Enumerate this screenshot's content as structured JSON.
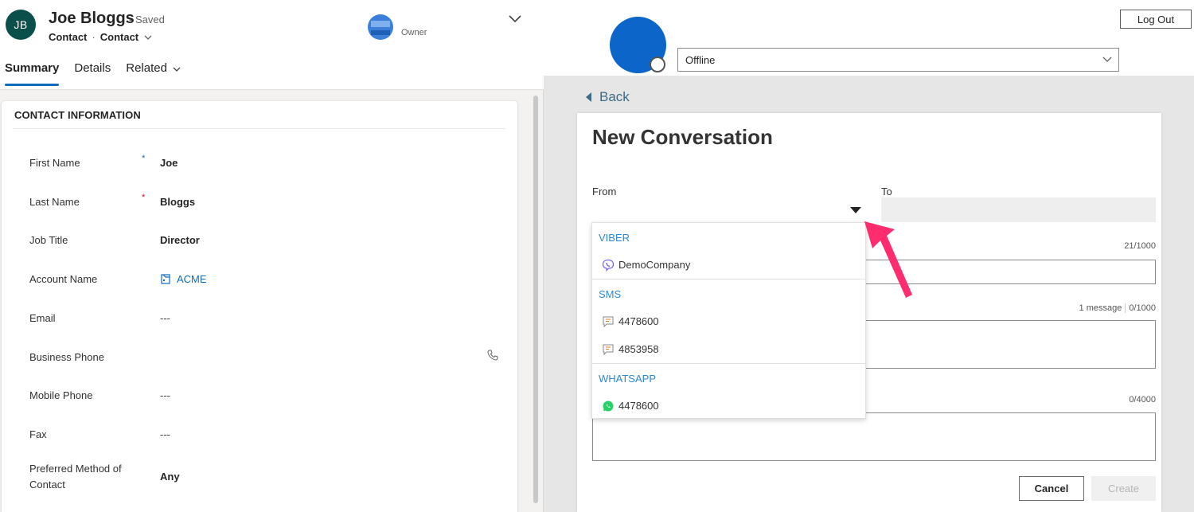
{
  "record": {
    "initials": "JB",
    "name": "Joe Bloggs",
    "saved": "- Saved",
    "entity": "Contact",
    "form": "Contact",
    "owner_label": "Owner"
  },
  "tabs": [
    {
      "label": "Summary"
    },
    {
      "label": "Details"
    },
    {
      "label": "Related"
    }
  ],
  "contact_section": {
    "title": "CONTACT INFORMATION",
    "fields": [
      {
        "label": "First Name",
        "required_marker": "*",
        "value": "Joe"
      },
      {
        "label": "Last Name",
        "required_marker": "*",
        "value": "Bloggs"
      },
      {
        "label": "Job Title",
        "value": "Director"
      },
      {
        "label": "Account Name",
        "value": "ACME"
      },
      {
        "label": "Email",
        "value": "---"
      },
      {
        "label": "Business Phone",
        "value": ""
      },
      {
        "label": "Mobile Phone",
        "value": "---"
      },
      {
        "label": "Fax",
        "value": "---"
      },
      {
        "label": "Preferred Method of Contact",
        "value": "Any"
      }
    ]
  },
  "agent": {
    "logout_label": "Log Out",
    "presence": "Offline"
  },
  "conversation": {
    "back_label": "Back",
    "title": "New Conversation",
    "from_label": "From",
    "to_label": "To",
    "counter_1": "21/1000",
    "counter_2_messages": "1 message",
    "counter_2": "0/1000",
    "counter_3": "0/4000",
    "cancel_label": "Cancel",
    "create_label": "Create"
  },
  "from_dropdown": {
    "groups": [
      {
        "name": "VIBER",
        "items": [
          {
            "label": "DemoCompany",
            "icon": "viber-icon"
          }
        ]
      },
      {
        "name": "SMS",
        "items": [
          {
            "label": "4478600",
            "icon": "sms-icon"
          },
          {
            "label": "4853958",
            "icon": "sms-icon"
          }
        ]
      },
      {
        "name": "WHATSAPP",
        "items": [
          {
            "label": "4478600",
            "icon": "whatsapp-icon"
          }
        ]
      }
    ]
  },
  "colors": {
    "accent": "#0f6cbd",
    "required": "#c50f1f",
    "avatar": "#0b4f4a",
    "agent_avatar": "#0c66c9",
    "dropdown_group": "#2b88d8",
    "annotation_arrow": "#ff2d6f"
  }
}
